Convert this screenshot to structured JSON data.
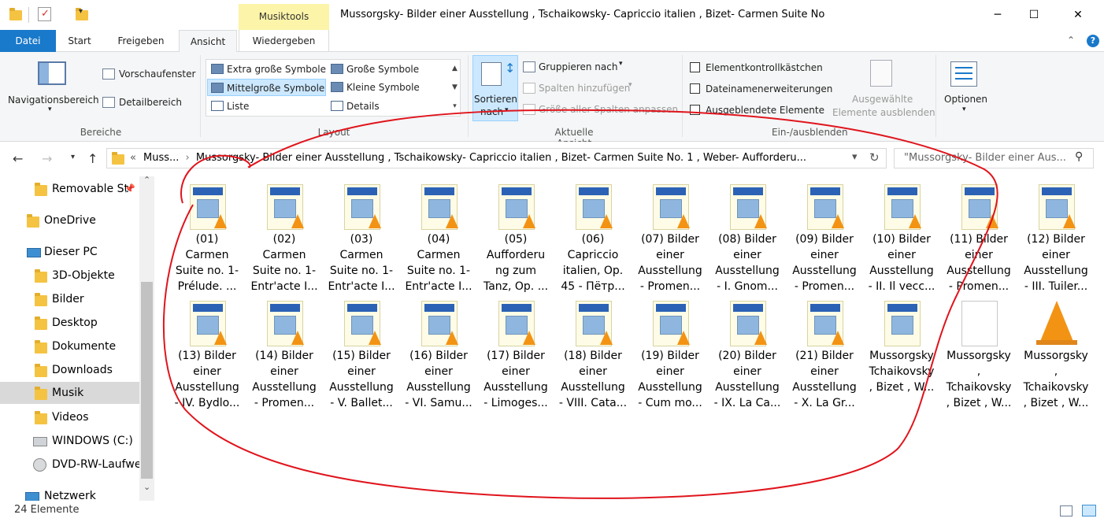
{
  "window": {
    "title": "Mussorgsky- Bilder einer Ausstellung , Tschaikowsky- Capriccio italien , Bizet- Carmen Suite No",
    "context_tab": "Musiktools"
  },
  "tabs": [
    "Datei",
    "Start",
    "Freigeben",
    "Ansicht",
    "Wiedergeben"
  ],
  "ribbon": {
    "bereiche": {
      "navigationsbereich": "Navigationsbereich",
      "vorschaufenster": "Vorschaufenster",
      "detailbereich": "Detailbereich",
      "label": "Bereiche"
    },
    "layout": {
      "items": [
        "Extra große Symbole",
        "Große Symbole",
        "Mittelgroße Symbole",
        "Kleine Symbole",
        "Liste",
        "Details"
      ],
      "selected": "Mittelgroße Symbole",
      "label": "Layout"
    },
    "aktuelle_ansicht": {
      "sortieren": "Sortieren",
      "nach": "nach",
      "gruppieren": "Gruppieren nach",
      "spalten": "Spalten hinzufügen",
      "groesse": "Größe aller Spalten anpassen",
      "label": "Aktuelle Ansicht"
    },
    "einausblenden": {
      "elementkontroll": "Elementkontrollkästchen",
      "dateinamen": "Dateinamenerweiterungen",
      "ausgeblendete": "Ausgeblendete Elemente",
      "ausgewaehlte_1": "Ausgewählte",
      "ausgewaehlte_2": "Elemente ausblenden",
      "label": "Ein-/ausblenden"
    },
    "optionen": "Optionen"
  },
  "address": {
    "chevrons": "«",
    "crumb1": "Muss...",
    "crumb2": "Mussorgsky- Bilder einer Ausstellung , Tschaikowsky- Capriccio italien , Bizet- Carmen Suite No. 1 , Weber- Aufforderu...",
    "search_placeholder": "\"Mussorgsky- Bilder einer Aus..."
  },
  "nav": {
    "items": [
      {
        "label": "Removable St",
        "icon": "folder-icon"
      },
      {
        "label": "OneDrive",
        "icon": "folder-icon"
      },
      {
        "label": "Dieser PC",
        "icon": "computer-icon"
      },
      {
        "label": "3D-Objekte",
        "icon": "folder-icon"
      },
      {
        "label": "Bilder",
        "icon": "folder-icon"
      },
      {
        "label": "Desktop",
        "icon": "folder-icon"
      },
      {
        "label": "Dokumente",
        "icon": "folder-icon"
      },
      {
        "label": "Downloads",
        "icon": "folder-icon"
      },
      {
        "label": "Musik",
        "icon": "music-folder-icon"
      },
      {
        "label": "Videos",
        "icon": "folder-icon"
      },
      {
        "label": "WINDOWS (C:)",
        "icon": "drive-icon"
      },
      {
        "label": "DVD-RW-Laufwe",
        "icon": "dvd-icon"
      },
      {
        "label": "Netzwerk",
        "icon": "network-icon"
      }
    ]
  },
  "files": [
    {
      "lines": [
        "(01)",
        "Carmen",
        "Suite no. 1-",
        "Prélude. ..."
      ],
      "kind": "album"
    },
    {
      "lines": [
        "(02)",
        "Carmen",
        "Suite no. 1-",
        "Entr'acte I..."
      ],
      "kind": "album"
    },
    {
      "lines": [
        "(03)",
        "Carmen",
        "Suite no. 1-",
        "Entr'acte I..."
      ],
      "kind": "album"
    },
    {
      "lines": [
        "(04)",
        "Carmen",
        "Suite no. 1-",
        "Entr'acte I..."
      ],
      "kind": "album"
    },
    {
      "lines": [
        "(05)",
        "Aufforderu",
        "ng zum",
        "Tanz, Op. ..."
      ],
      "kind": "album"
    },
    {
      "lines": [
        "(06)",
        "Capriccio",
        "italien, Op.",
        "45 - Пётр..."
      ],
      "kind": "album"
    },
    {
      "lines": [
        "(07) Bilder",
        "einer",
        "Ausstellung",
        "- Promen..."
      ],
      "kind": "album"
    },
    {
      "lines": [
        "(08) Bilder",
        "einer",
        "Ausstellung",
        "- I. Gnom..."
      ],
      "kind": "album"
    },
    {
      "lines": [
        "(09) Bilder",
        "einer",
        "Ausstellung",
        "- Promen..."
      ],
      "kind": "album"
    },
    {
      "lines": [
        "(10) Bilder",
        "einer",
        "Ausstellung",
        "- II. Il vecc..."
      ],
      "kind": "album"
    },
    {
      "lines": [
        "(11) Bilder",
        "einer",
        "Ausstellung",
        "- Promen..."
      ],
      "kind": "album"
    },
    {
      "lines": [
        "(12) Bilder",
        "einer",
        "Ausstellung",
        "- III. Tuiler..."
      ],
      "kind": "album"
    },
    {
      "lines": [
        "(13) Bilder",
        "einer",
        "Ausstellung",
        "- IV. Bydlo..."
      ],
      "kind": "album"
    },
    {
      "lines": [
        "(14) Bilder",
        "einer",
        "Ausstellung",
        "- Promen..."
      ],
      "kind": "album"
    },
    {
      "lines": [
        "(15) Bilder",
        "einer",
        "Ausstellung",
        "- V. Ballet..."
      ],
      "kind": "album"
    },
    {
      "lines": [
        "(16) Bilder",
        "einer",
        "Ausstellung",
        "- VI. Samu..."
      ],
      "kind": "album"
    },
    {
      "lines": [
        "(17) Bilder",
        "einer",
        "Ausstellung",
        "- Limoges..."
      ],
      "kind": "album"
    },
    {
      "lines": [
        "(18) Bilder",
        "einer",
        "Ausstellung",
        "- VIII. Cata..."
      ],
      "kind": "album"
    },
    {
      "lines": [
        "(19) Bilder",
        "einer",
        "Ausstellung",
        "- Cum mo..."
      ],
      "kind": "album"
    },
    {
      "lines": [
        "(20) Bilder",
        "einer",
        "Ausstellung",
        "- IX. La Ca..."
      ],
      "kind": "album"
    },
    {
      "lines": [
        "(21) Bilder",
        "einer",
        "Ausstellung",
        "- X. La Gr..."
      ],
      "kind": "album"
    },
    {
      "lines": [
        "Mussorgsky",
        "Tchaikovsky",
        ", Bizet , W..."
      ],
      "kind": "image"
    },
    {
      "lines": [
        "Mussorgsky",
        ",",
        "Tchaikovsky",
        ", Bizet , W..."
      ],
      "kind": "document"
    },
    {
      "lines": [
        "Mussorgsky",
        ",",
        "Tchaikovsky",
        ", Bizet , W..."
      ],
      "kind": "playlist"
    }
  ],
  "status": {
    "count": "24 Elemente"
  },
  "colors": {
    "accent": "#1979ca",
    "musiktools": "#fcf4a8",
    "annotation": "#e0141c"
  }
}
